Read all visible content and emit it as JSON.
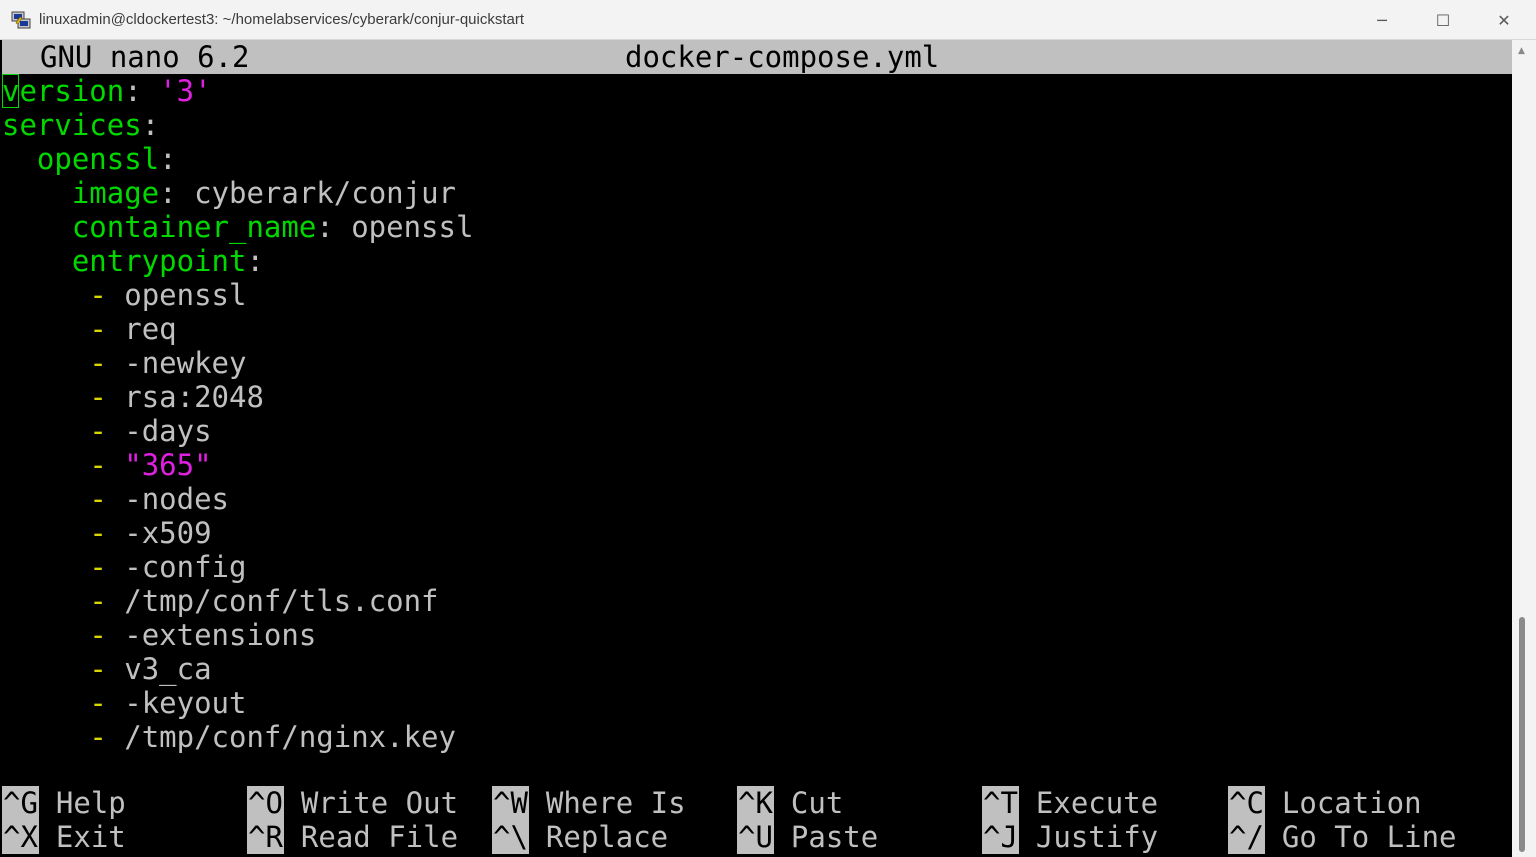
{
  "window": {
    "title": "linuxadmin@cldockertest3: ~/homelabservices/cyberark/conjur-quickstart",
    "icons": {
      "app": "putty-icon",
      "minimize": "minimize-icon",
      "maximize": "maximize-icon",
      "close": "close-icon"
    },
    "controls": {
      "minimize": "─",
      "maximize": "☐",
      "close": "✕"
    }
  },
  "nano": {
    "version": "GNU nano 6.2",
    "filename": "docker-compose.yml"
  },
  "editor": {
    "lines": {
      "l0": {
        "key_first": "v",
        "key_rest": "ersion",
        "sep": ":",
        "value": "'3'"
      },
      "l1": {
        "key": "services",
        "sep": ":"
      },
      "l2": {
        "key": "openssl",
        "sep": ":"
      },
      "l3": {
        "key": "image",
        "sep": ":",
        "value": "cyberark/conjur"
      },
      "l4": {
        "key": "container_name",
        "sep": ":",
        "value": "openssl"
      },
      "l5": {
        "key": "entrypoint",
        "sep": ":"
      },
      "items": [
        {
          "dash": "-",
          "value": "openssl",
          "string": false
        },
        {
          "dash": "-",
          "value": "req",
          "string": false
        },
        {
          "dash": "-",
          "value": "-newkey",
          "string": false
        },
        {
          "dash": "-",
          "value": "rsa:2048",
          "string": false
        },
        {
          "dash": "-",
          "value": "-days",
          "string": false
        },
        {
          "dash": "-",
          "value": "\"365\"",
          "string": true
        },
        {
          "dash": "-",
          "value": "-nodes",
          "string": false
        },
        {
          "dash": "-",
          "value": "-x509",
          "string": false
        },
        {
          "dash": "-",
          "value": "-config",
          "string": false
        },
        {
          "dash": "-",
          "value": "/tmp/conf/tls.conf",
          "string": false
        },
        {
          "dash": "-",
          "value": "-extensions",
          "string": false
        },
        {
          "dash": "-",
          "value": "v3_ca",
          "string": false
        },
        {
          "dash": "-",
          "value": "-keyout",
          "string": false
        },
        {
          "dash": "-",
          "value": "/tmp/conf/nginx.key",
          "string": false
        }
      ]
    }
  },
  "shortcuts": {
    "row1": [
      {
        "key": "^G",
        "label": "Help"
      },
      {
        "key": "^O",
        "label": "Write Out"
      },
      {
        "key": "^W",
        "label": "Where Is"
      },
      {
        "key": "^K",
        "label": "Cut"
      },
      {
        "key": "^T",
        "label": "Execute"
      },
      {
        "key": "^C",
        "label": "Location"
      }
    ],
    "row2": [
      {
        "key": "^X",
        "label": "Exit"
      },
      {
        "key": "^R",
        "label": "Read File"
      },
      {
        "key": "^\\",
        "label": "Replace"
      },
      {
        "key": "^U",
        "label": "Paste"
      },
      {
        "key": "^J",
        "label": "Justify"
      },
      {
        "key": "^/",
        "label": "Go To Line"
      }
    ]
  },
  "colors": {
    "key": "#00d800",
    "string": "#e020e0",
    "text": "#c0c0c0",
    "dash": "#d8d800",
    "background": "#000000",
    "header_bg": "#c0c0c0"
  }
}
